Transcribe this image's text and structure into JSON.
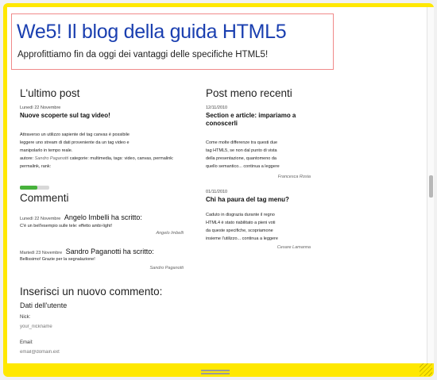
{
  "header": {
    "title": "We5! Il blog della guida HTML5",
    "tagline": "Approfittiamo fin da oggi dei vantaggi delle specifiche HTML5!"
  },
  "latest_post": {
    "heading": "L'ultimo post",
    "date": "Lunedì 22 Novembre",
    "title": "Nuove scoperte sul tag video!",
    "body_lines": [
      "Attraverso un utilizzo sapiente del tag canvas è possibile",
      "leggere uno stream di dati proveniente da un tag video e",
      "manipolarlo in tempo reale."
    ],
    "meta_prefix": "autore:",
    "meta_author": "Sandro Paganotti",
    "meta_categories": "categorie: multimedia, tags: video, canvas, permalink: permalink, rank:",
    "rank_progress": 0.6
  },
  "comments": {
    "heading": "Commenti",
    "items": [
      {
        "date": "Lunedì 22 Novembre",
        "who": "Angelo Imbelli ha scritto:",
        "text": "C'è un bell'esempio sulle tele: effetto ambi-light!",
        "signature": "Angelo Imbelli"
      },
      {
        "date": "Martedì 23 Novembre",
        "who": "Sandro Paganotti ha scritto:",
        "text": "Bellissimo! Grazie per la segnalazione!",
        "signature": "Sandro Paganotti"
      }
    ]
  },
  "comment_form": {
    "heading": "Inserisci un nuovo commento:",
    "subheading": "Dati dell'utente",
    "nick_label": "Nick:",
    "nick_placeholder": "your_nickname",
    "email_label": "Email:",
    "email_placeholder": "email@domain.ext"
  },
  "recent_posts": {
    "heading": "Post meno recenti",
    "items": [
      {
        "date": "12/11/2010",
        "title": "Section e article: impariamo a conoscerli",
        "lines": [
          "Come molte differenze tra questi due",
          "tag HTML5, se non dal punto di vista",
          "della presentazione, quantomeno da",
          "quello semantico... continua a leggere"
        ],
        "author": "Francesca Rosia"
      },
      {
        "date": "01/11/2010",
        "title": "Chi ha paura del tag menu?",
        "lines": [
          "Caduto in disgrazia durante il regno",
          "HTML4 è stato riabilitato a pieni voti",
          "da queste specifiche, scopriamone",
          "insieme l'utilizzo... continua a leggere"
        ],
        "author": "Cesare Lamanna"
      }
    ]
  },
  "colors": {
    "frame": "#ffe800",
    "title": "#1a3fb0",
    "header_border": "#f08a8a",
    "progress": "#47b23c"
  }
}
